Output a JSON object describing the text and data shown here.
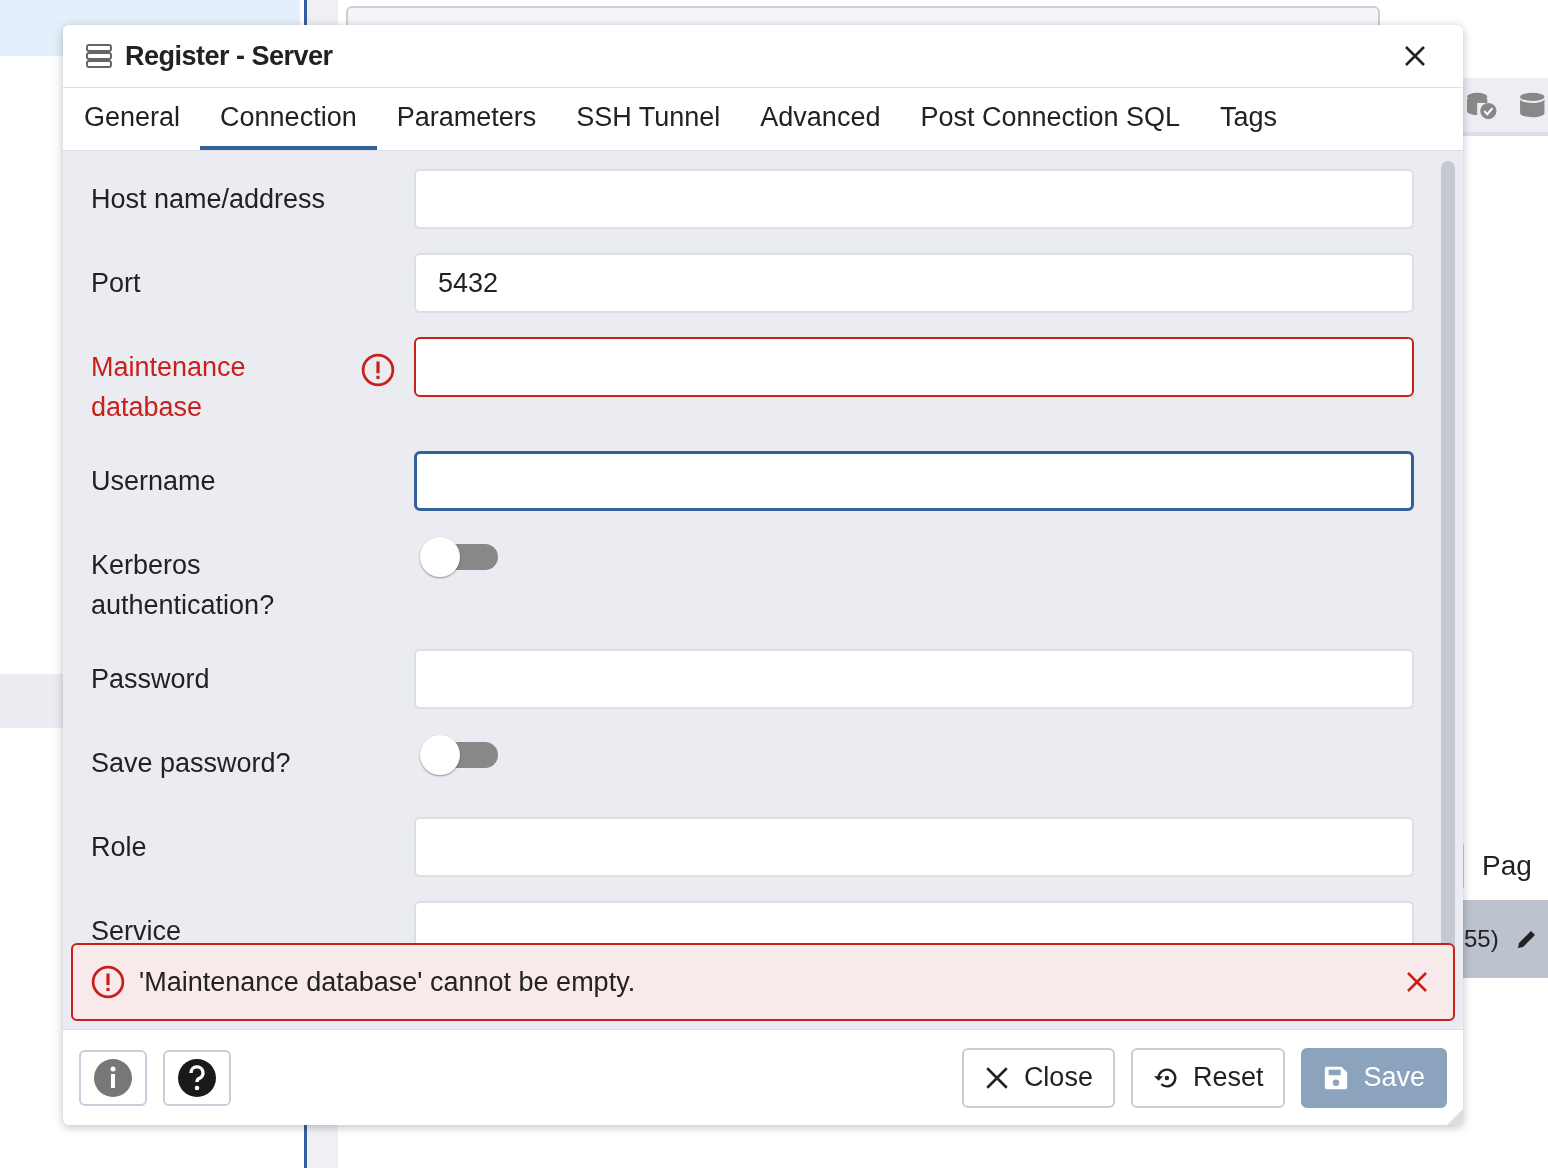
{
  "background": {
    "pager_label": "Pag",
    "row_text": "55)"
  },
  "dialog": {
    "title": "Register - Server",
    "tabs": [
      {
        "label": "General",
        "selected": false
      },
      {
        "label": "Connection",
        "selected": true
      },
      {
        "label": "Parameters",
        "selected": false
      },
      {
        "label": "SSH Tunnel",
        "selected": false
      },
      {
        "label": "Advanced",
        "selected": false
      },
      {
        "label": "Post Connection SQL",
        "selected": false
      },
      {
        "label": "Tags",
        "selected": false
      }
    ],
    "fields": [
      {
        "kind": "text",
        "label": "Host name/address",
        "error": false,
        "focused": false
      },
      {
        "kind": "text",
        "label": "Port",
        "value": "5432",
        "error": false,
        "focused": false
      },
      {
        "kind": "text",
        "label": "Maintenance database",
        "error": true,
        "focused": false
      },
      {
        "kind": "text",
        "label": "Username",
        "error": false,
        "focused": true
      },
      {
        "kind": "toggle",
        "label": "Kerberos authentication?",
        "on": false
      },
      {
        "kind": "text",
        "label": "Password",
        "error": false,
        "focused": false
      },
      {
        "kind": "toggle",
        "label": "Save password?",
        "on": false
      },
      {
        "kind": "text",
        "label": "Role",
        "error": false,
        "focused": false
      },
      {
        "kind": "text",
        "label": "Service",
        "error": false,
        "focused": false
      }
    ],
    "error_message": "'Maintenance database' cannot be empty.",
    "buttons": [
      {
        "kind": "close",
        "label": "Close",
        "disabled": false
      },
      {
        "kind": "reset",
        "label": "Reset",
        "disabled": false
      },
      {
        "kind": "save",
        "label": "Save",
        "disabled": true
      }
    ]
  }
}
